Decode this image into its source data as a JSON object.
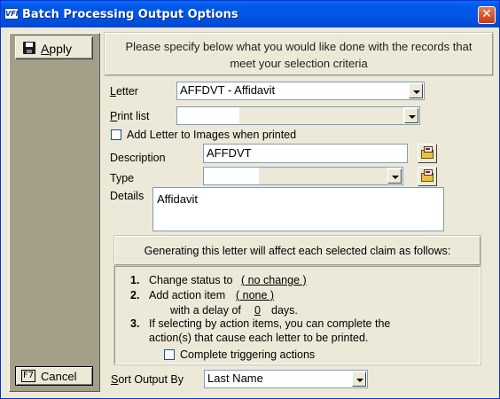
{
  "window": {
    "title": "Batch Processing Output Options",
    "close_glyph": "✕",
    "icon_text": "VFI"
  },
  "left": {
    "apply_label": "Apply",
    "apply_accel": "A",
    "apply_rest": "pply",
    "cancel_key": "F7",
    "cancel_label": "Cancel"
  },
  "header": {
    "line1": "Please specify below what you would like done with the records that",
    "line2": "meet your selection criteria"
  },
  "form": {
    "letter_label_accel": "L",
    "letter_label_rest": "etter",
    "letter_value": "AFFDVT - Affidavit",
    "printlist_label_accel": "P",
    "printlist_label_rest": "rint list",
    "printlist_value": "",
    "add_images_label": "Add Letter to Images when printed",
    "add_images_checked": false,
    "description_label": "Description",
    "description_value": "AFFDVT",
    "type_label": "Type",
    "type_value": "",
    "details_label": "Details",
    "details_value": "Affidavit"
  },
  "effects": {
    "heading": "Generating this letter will affect each selected claim as follows:",
    "item1_num": "1.",
    "item1_text": "Change status to",
    "item1_link": "( no change )",
    "item2_num": "2.",
    "item2_text": "Add action item",
    "item2_link": "( none )",
    "item2_delay_pre": "with a delay of",
    "item2_delay_value": "0",
    "item2_delay_post": "days.",
    "item3_num": "3.",
    "item3_line1": "If selecting by action items, you can complete the",
    "item3_line2": "action(s) that cause each letter to be printed.",
    "complete_label": "Complete triggering actions",
    "complete_checked": false
  },
  "sort": {
    "label_accel": "S",
    "label_rest": "ort Output By",
    "value": "Last Name"
  }
}
